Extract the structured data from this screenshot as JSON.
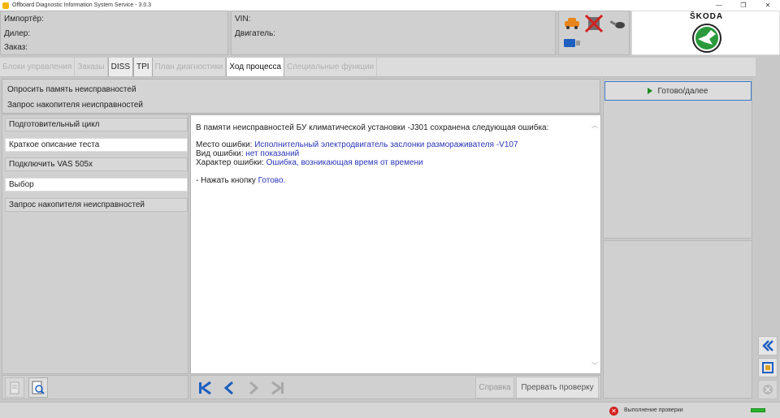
{
  "window": {
    "title": "Offboard Diagnostic Information System Service - 3.0.3",
    "controls": {
      "minimize": "—",
      "restore": "❐",
      "close": "✕"
    }
  },
  "header": {
    "importer_label": "Импортёр:",
    "dealer_label": "Дилер:",
    "order_label": "Заказ:",
    "vin_label": "VIN:",
    "engine_label": "Двигатель:",
    "brand": "ŠKODA"
  },
  "tabs": [
    {
      "label": "Блоки управления",
      "enabled": false
    },
    {
      "label": "Заказы",
      "enabled": false
    },
    {
      "label": "DISS",
      "enabled": true
    },
    {
      "label": "TPI",
      "enabled": true
    },
    {
      "label": "План диагностики",
      "enabled": false
    },
    {
      "label": "Ход процесса",
      "enabled": true,
      "active": true
    },
    {
      "label": "Специальные функции",
      "enabled": false
    }
  ],
  "info": {
    "line1": "Опросить память неисправностей",
    "line2": "Запрос накопителя неисправностей"
  },
  "next_button": {
    "label": "Готово/далее"
  },
  "steps": [
    {
      "label": "Подготовительный цикл",
      "done": false
    },
    {
      "label": "Краткое описание теста",
      "done": true
    },
    {
      "label": "Подключить VAS 505x",
      "done": false
    },
    {
      "label": "Выбор",
      "done": true
    },
    {
      "label": "Запрос накопителя неисправностей",
      "done": false
    }
  ],
  "main": {
    "intro": "В памяти неисправностей БУ климатической установки -J301  сохранена следующая ошибка:",
    "location_label": "Место ошибки: ",
    "location_value": "Исполнительный электродвигатель заслонки размораживателя -V107",
    "type_label": "Вид ошибки: ",
    "type_value": "нет показаний",
    "nature_label": "Характер ошибки: ",
    "nature_value": "Ошибка, возникающая время от времени",
    "instruction_prefix": "- Нажать кнопку ",
    "instruction_link": "Готово."
  },
  "toolbar": {
    "help_label": "Справка",
    "abort_label": "Прервать проверку"
  },
  "status": {
    "text": "Выполнение проверки"
  },
  "colors": {
    "accent": "#2a35b8",
    "nav_blue": "#1e5fbf",
    "error": "#d42020",
    "ok": "#2bb52b"
  }
}
